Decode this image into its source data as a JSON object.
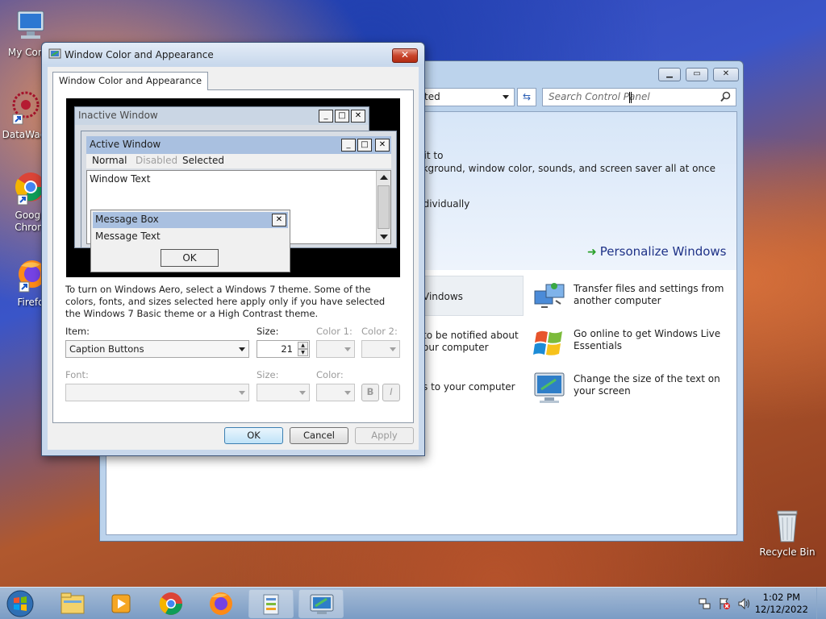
{
  "desktop": {
    "icons": [
      {
        "label": "My Comp"
      },
      {
        "label": "DataWag"
      },
      {
        "label": "Googl"
      },
      {
        "label": "Chron"
      },
      {
        "label": "Firefo"
      },
      {
        "label": "Recycle Bin"
      }
    ]
  },
  "control_panel": {
    "address_fragment": "tarted",
    "search_placeholder": "Search Control Panel",
    "banner_lines": [
      "t it to",
      "ckground, window color, sounds, and screen saver all at once",
      "ndividually"
    ],
    "personalize_link": "Personalize Windows",
    "left_items": [
      "Vindows",
      "to be notified about",
      "our computer",
      "s to your computer"
    ],
    "tasks": [
      {
        "text": "Transfer files and settings from another computer"
      },
      {
        "text": "Go online to get Windows Live Essentials"
      },
      {
        "text": "Change the size of the text on your screen"
      }
    ]
  },
  "dialog": {
    "title": "Window Color and Appearance",
    "tab_label": "Window Color and Appearance",
    "preview": {
      "inactive_title": "Inactive Window",
      "active_title": "Active Window",
      "menu_normal": "Normal",
      "menu_disabled": "Disabled",
      "menu_selected": "Selected",
      "window_text": "Window Text",
      "message_title": "Message Box",
      "message_text": "Message Text",
      "message_ok": "OK"
    },
    "info_text": "To turn on Windows Aero, select a Windows 7 theme.  Some of the colors, fonts, and sizes selected here apply only if you have selected the Windows 7 Basic theme or a High Contrast theme.",
    "item_label": "Item:",
    "item_value": "Caption Buttons",
    "size_label": "Size:",
    "size_value": "21",
    "color1_label": "Color 1:",
    "color2_label": "Color 2:",
    "font_label": "Font:",
    "font_size_label": "Size:",
    "font_color_label": "Color:",
    "bold_label": "B",
    "italic_label": "I",
    "ok_label": "OK",
    "cancel_label": "Cancel",
    "apply_label": "Apply"
  },
  "taskbar": {
    "time": "1:02 PM",
    "date": "12/12/2022"
  },
  "colors": {
    "active_title": "#a9c0e0",
    "inactive_title": "#cad6e4",
    "selected_menu": "#3399ff",
    "link": "#1e3287"
  }
}
